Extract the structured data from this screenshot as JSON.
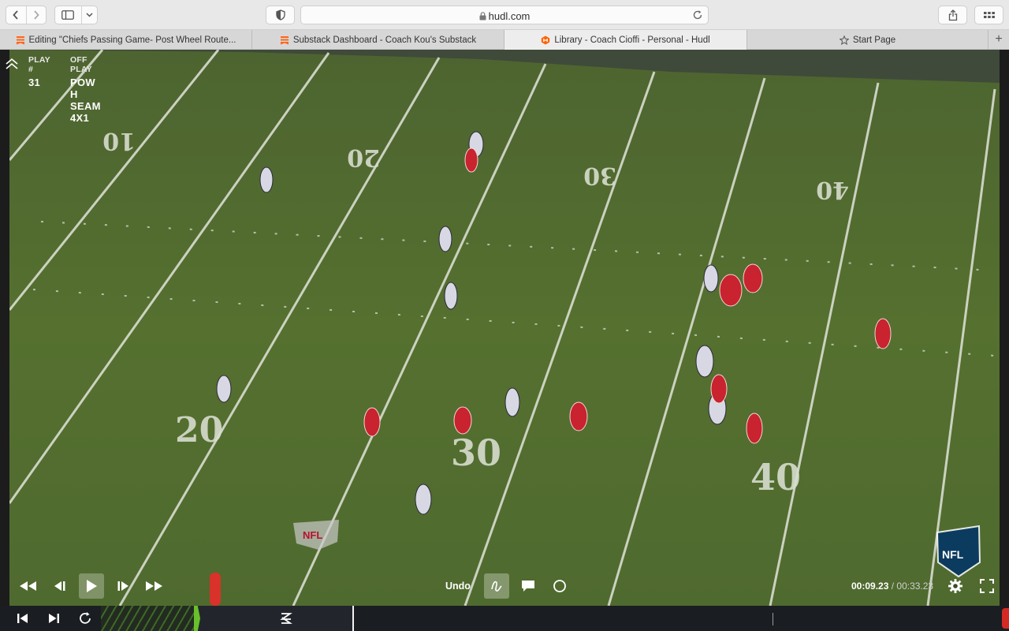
{
  "browser": {
    "url": "hudl.com",
    "icons": [
      "chevron-left-icon",
      "chevron-right-icon",
      "sidebar-icon",
      "chevron-down-icon",
      "shield-icon",
      "lock-icon",
      "reload-icon",
      "share-icon",
      "grid-icon"
    ]
  },
  "tabs": [
    {
      "label": "Editing \"Chiefs Passing Game- Post Wheel Route...",
      "favicon": "substack",
      "active": false
    },
    {
      "label": "Substack Dashboard - Coach Kou's Substack",
      "favicon": "substack",
      "active": false
    },
    {
      "label": "Library - Coach Cioffi - Personal - Hudl",
      "favicon": "hudl",
      "active": true
    },
    {
      "label": "Start Page",
      "favicon": "star",
      "active": false
    }
  ],
  "tab_add_label": "+",
  "play_info": {
    "play_label": "PLAY #",
    "play_value": "31",
    "off_play_label": "OFF PLAY",
    "off_play_value": "POW H SEAM 4X1"
  },
  "field": {
    "yard_numbers_far": [
      "10",
      "20",
      "30",
      "40"
    ],
    "yard_numbers_near": [
      "20",
      "30",
      "40"
    ],
    "logo_text": "NFL",
    "colors": {
      "turf": "#51692f",
      "chiefs": "#c8102e",
      "ravens": "#d6d6e6",
      "lines": "#e4e8dc"
    }
  },
  "controls": {
    "undo_label": "Undo",
    "current_time": "00:09.23",
    "separator": " / ",
    "duration": "00:33.23",
    "icons": [
      "rewind-icon",
      "step-back-icon",
      "play-icon",
      "step-forward-icon",
      "fast-forward-icon",
      "pen-icon",
      "comment-icon",
      "circle-icon",
      "settings-icon",
      "fullscreen-icon"
    ]
  },
  "timeline": {
    "icons": [
      "skip-start-icon",
      "skip-end-icon",
      "loop-icon",
      "clip-tag-icon"
    ],
    "accent": "#68c02a",
    "end_marker": "#d42a23"
  }
}
